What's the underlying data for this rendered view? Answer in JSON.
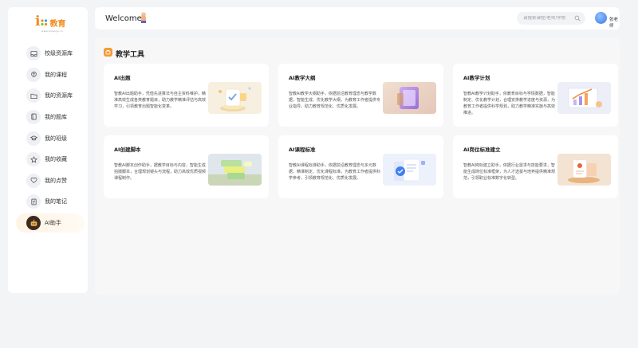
{
  "app": {
    "logo_mark": "i",
    "logo_text": "教育",
    "logo_sub": "www.aijiaoyu.cn"
  },
  "sidebar": {
    "items": [
      {
        "label": "校级资源库",
        "icon": "inbox-icon",
        "active": false
      },
      {
        "label": "我的课程",
        "icon": "brain-icon",
        "active": false
      },
      {
        "label": "我的资源库",
        "icon": "folder-icon",
        "active": false
      },
      {
        "label": "我的题库",
        "icon": "book-icon",
        "active": false
      },
      {
        "label": "我的班级",
        "icon": "graduation-cap-icon",
        "active": false
      },
      {
        "label": "我的收藏",
        "icon": "star-icon",
        "active": false
      },
      {
        "label": "我的点赞",
        "icon": "heart-icon",
        "active": false
      },
      {
        "label": "我的笔记",
        "icon": "notes-icon",
        "active": false
      },
      {
        "label": "AI助手",
        "icon": "robot-icon",
        "active": true
      }
    ]
  },
  "header": {
    "welcome": "Welcome!",
    "search_placeholder": "请搜索课程/老师/学校",
    "user_name": "张老师"
  },
  "main": {
    "section_title": "教学工具",
    "cards": [
      {
        "title": "AI出题",
        "desc": "智教AI出题助手，凭借先进算法与自主资料维护，精准高效生成各类教育题目，助力教学精准评估与高效学习，引领教育出题智能化变革。",
        "image": "exam-paper-illustration"
      },
      {
        "title": "AI教学大纲",
        "desc": "智教AI教学大纲助手，依据前沿教育理念与教学数据，智能生成、优化教学大纲，为教育工作者提供专业指导，助力教育规范化、优质化发展。",
        "image": "syllabus-cube-illustration"
      },
      {
        "title": "AI教学计划",
        "desc": "智教AI教学计划助手，依教育目标与学情数据，智能制定、优化教学计划，合理安排教学进度与资源，为教育工作者提供科学规划，助力教学精准实施与高效推进。",
        "image": "growth-chart-illustration"
      },
      {
        "title": "AI创建脚本",
        "desc": "智教AI脚本创作助手，据教学目标与内容，智能生成拍摄脚本，合理规划镜头与流程，助力高效优质视频课程制作。",
        "image": "script-cards-illustration"
      },
      {
        "title": "AI课程标准",
        "desc": "智教AI课程标准助手，依据前沿教育理念与多元数据，精准制定、优化课程标准，为教育工作者提供科学参考，引领教育规范化、优质化发展。",
        "image": "standard-docs-illustration"
      },
      {
        "title": "AI岗位标准建立",
        "desc": "智教AI岗标建立助手，依据行业需求与技能要求，智能生成岗位标准框架，为人才选拔与培养提供精准规范，引领职业标准数字化转型。",
        "image": "job-badge-illustration"
      }
    ]
  },
  "colors": {
    "accent": "#f39a34",
    "brand": "#f28a1e",
    "avatar": "#3b79e0"
  }
}
